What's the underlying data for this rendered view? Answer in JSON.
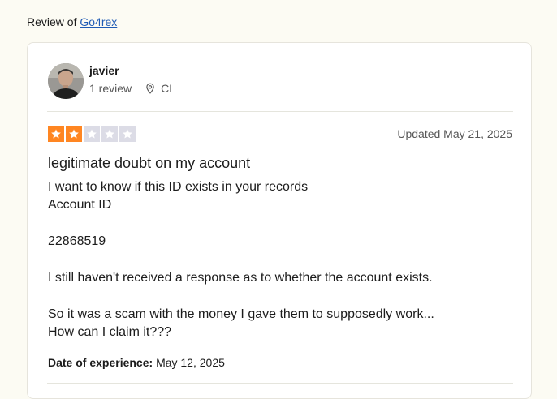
{
  "header": {
    "prefix": "Review of",
    "company_link": "Go4rex"
  },
  "reviewer": {
    "name": "javier",
    "review_count": "1 review",
    "country": "CL",
    "avatar_icon": "user-photo"
  },
  "review": {
    "rating": 2,
    "rating_max": 5,
    "rating_color": "#ff8622",
    "empty_star_color": "#dcdce6",
    "updated": "Updated May 21, 2025",
    "title": "legitimate doubt on my account",
    "body": "I want to know if this ID exists in your records\nAccount ID\n\n22868519\n\nI still haven't received a response as to whether the account exists.\n\nSo it was a scam with the money I gave them to supposedly work...\nHow can I claim it???",
    "experience_label": "Date of experience:",
    "experience_date": "May 12, 2025"
  }
}
